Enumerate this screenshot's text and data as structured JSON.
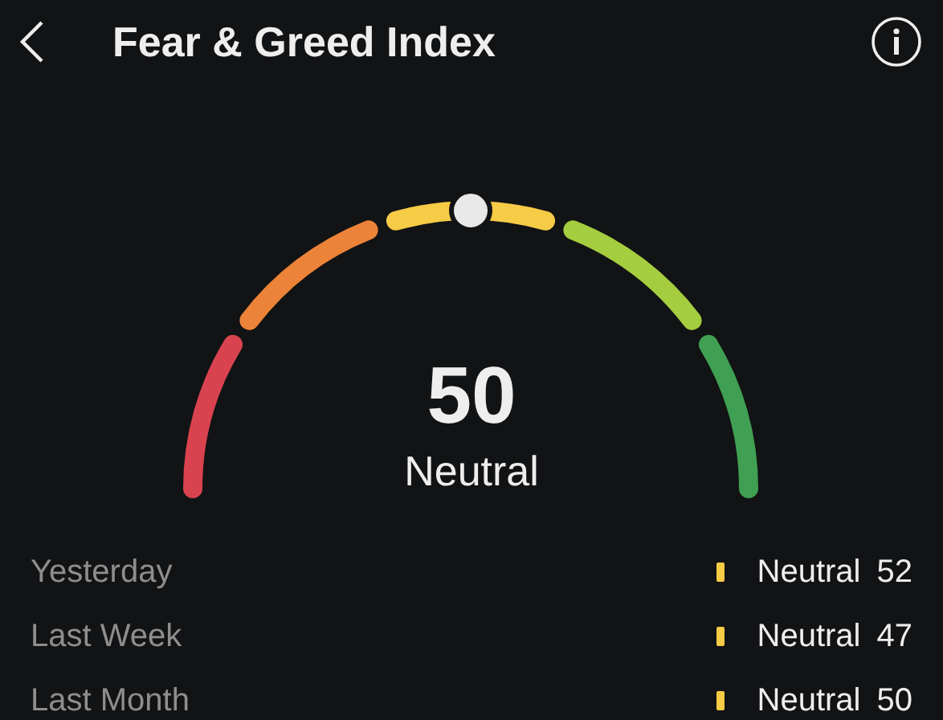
{
  "header": {
    "title": "Fear & Greed Index"
  },
  "gauge": {
    "value": "50",
    "label": "Neutral",
    "segments": [
      {
        "color": "#d9434f"
      },
      {
        "color": "#ec8338"
      },
      {
        "color": "#f6cb45"
      },
      {
        "color": "#a4cd3f"
      },
      {
        "color": "#3f9f52"
      }
    ]
  },
  "history": [
    {
      "period": "Yesterday",
      "label": "Neutral",
      "value": "52",
      "color": "#f6cb45"
    },
    {
      "period": "Last Week",
      "label": "Neutral",
      "value": "47",
      "color": "#f6cb45"
    },
    {
      "period": "Last Month",
      "label": "Neutral",
      "value": "50",
      "color": "#f6cb45"
    }
  ]
}
